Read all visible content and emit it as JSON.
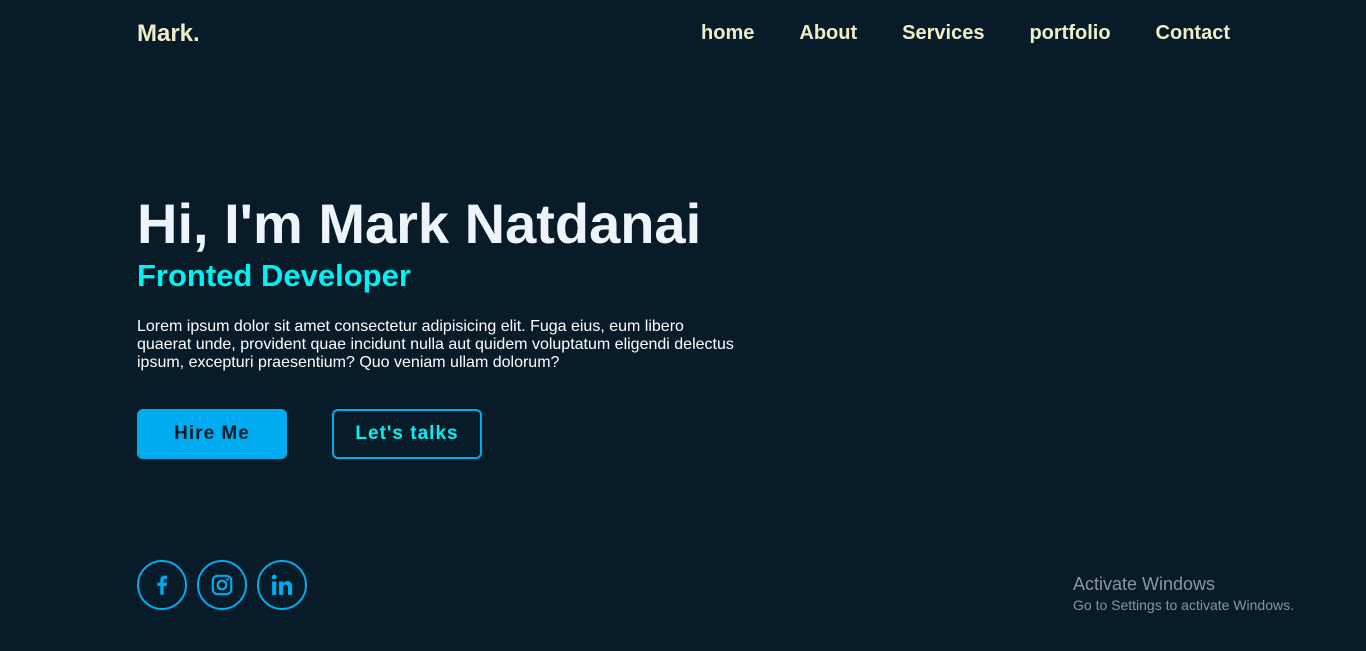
{
  "header": {
    "logo": "Mark.",
    "nav": [
      "home",
      "About",
      "Services",
      "portfolio",
      "Contact"
    ]
  },
  "hero": {
    "title": "Hi, I'm Mark Natdanai",
    "subtitle": "Fronted Developer",
    "description": "Lorem ipsum dolor sit amet consectetur adipisicing elit. Fuga eius, eum libero quaerat unde, provident quae incidunt nulla aut quidem voluptatum eligendi delectus ipsum, excepturi praesentium? Quo veniam ullam dolorum?",
    "primary_button": "Hire Me",
    "secondary_button": "Let's talks"
  },
  "social": {
    "icons": [
      "facebook-icon",
      "instagram-icon",
      "linkedin-icon"
    ]
  },
  "watermark": {
    "title": "Activate Windows",
    "subtitle": "Go to Settings to activate Windows."
  },
  "colors": {
    "background": "#081b29",
    "accent": "#00abf0",
    "highlight": "#00f2f2",
    "nav_text": "#ededc8"
  }
}
